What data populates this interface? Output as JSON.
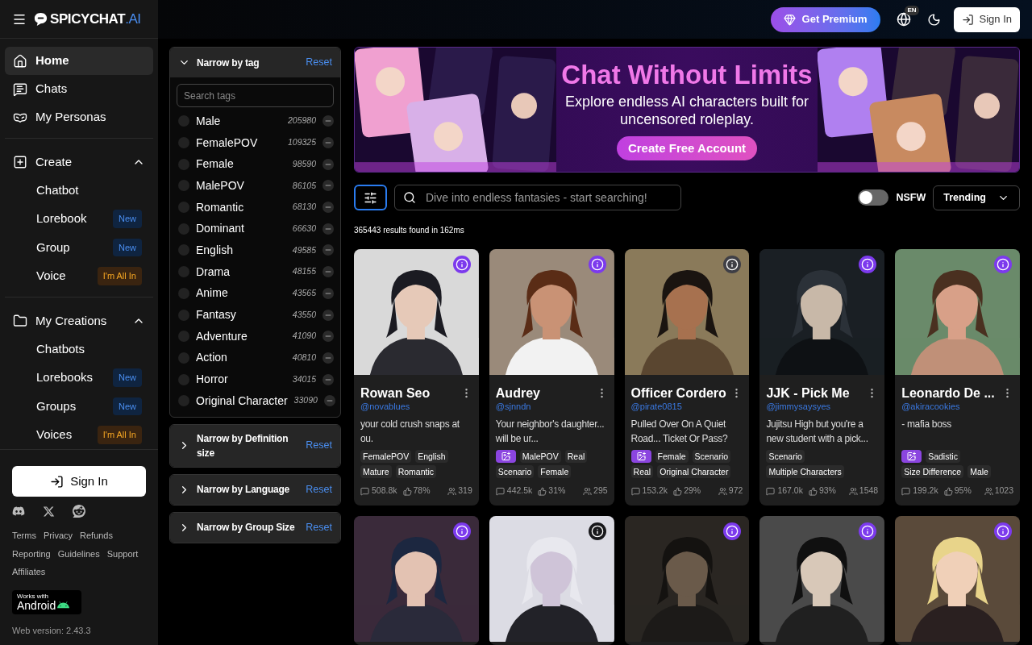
{
  "sidebar": {
    "logo": {
      "main": "SPICYCHAT",
      "suffix": ".AI"
    },
    "nav": [
      {
        "label": "Home",
        "selected": true
      },
      {
        "label": "Chats",
        "selected": false
      },
      {
        "label": "My Personas",
        "selected": false
      }
    ],
    "sections": [
      {
        "label": "Create",
        "expanded": true,
        "items": [
          {
            "label": "Chatbot"
          },
          {
            "label": "Lorebook",
            "badge": {
              "text": "New",
              "kind": "new"
            }
          },
          {
            "label": "Group",
            "badge": {
              "text": "New",
              "kind": "new"
            }
          },
          {
            "label": "Voice",
            "badge": {
              "text": "I'm All In",
              "kind": "premium"
            }
          }
        ]
      },
      {
        "label": "My Creations",
        "expanded": true,
        "items": [
          {
            "label": "Chatbots"
          },
          {
            "label": "Lorebooks",
            "badge": {
              "text": "New",
              "kind": "new"
            }
          },
          {
            "label": "Groups",
            "badge": {
              "text": "New",
              "kind": "new"
            }
          },
          {
            "label": "Voices",
            "badge": {
              "text": "I'm All In",
              "kind": "premium"
            }
          }
        ]
      }
    ],
    "sign_in": "Sign In",
    "links": [
      "Terms",
      "Privacy",
      "Refunds",
      "Reporting",
      "Guidelines",
      "Support",
      "Affiliates"
    ],
    "android_badge": {
      "small": "Works with",
      "big": "Android"
    },
    "version": "Web version: 2.43.3"
  },
  "header": {
    "premium": "Get Premium",
    "language": "EN",
    "sign_in": "Sign In"
  },
  "filters": [
    {
      "kind": "tags",
      "title": "Narrow by tag",
      "reset": "Reset",
      "expanded": true,
      "search_placeholder": "Search tags",
      "tags": [
        {
          "label": "Male",
          "count": "205980",
          "checked": false
        },
        {
          "label": "FemalePOV",
          "count": "109325",
          "checked": false
        },
        {
          "label": "Female",
          "count": "98590",
          "checked": false
        },
        {
          "label": "MalePOV",
          "count": "86105",
          "checked": false
        },
        {
          "label": "Romantic",
          "count": "68130",
          "checked": false
        },
        {
          "label": "Dominant",
          "count": "66630",
          "checked": false
        },
        {
          "label": "English",
          "count": "49585",
          "checked": false
        },
        {
          "label": "Drama",
          "count": "48155",
          "checked": false
        },
        {
          "label": "Anime",
          "count": "43565",
          "checked": false
        },
        {
          "label": "Fantasy",
          "count": "43550",
          "checked": false
        },
        {
          "label": "Adventure",
          "count": "41090",
          "checked": false
        },
        {
          "label": "Action",
          "count": "40810",
          "checked": false
        },
        {
          "label": "Horror",
          "count": "34015",
          "checked": false
        },
        {
          "label": "Original Character",
          "count": "33090",
          "checked": false
        }
      ]
    },
    {
      "kind": "plain",
      "title": "Narrow by Definition size",
      "reset": "Reset",
      "expanded": false
    },
    {
      "kind": "plain",
      "title": "Narrow by Language",
      "reset": "Reset",
      "expanded": false
    },
    {
      "kind": "plain",
      "title": "Narrow by Group Size",
      "reset": "Reset",
      "expanded": false
    }
  ],
  "banner": {
    "title": "Chat Without Limits",
    "subtitle": "Explore endless AI characters built for uncensored roleplay.",
    "button": "Create Free Account"
  },
  "toolbar": {
    "search_placeholder": "Dive into endless fantasies - start searching!",
    "nsfw": {
      "label": "NSFW",
      "on": false
    },
    "sort": "Trending",
    "results": "365443 results found in 162ms"
  },
  "cards": [
    {
      "kind": "full",
      "color": "#7c3aed",
      "name": "Rowan Seo",
      "handle": "@novablues",
      "description": "your cold crush snaps at ou.",
      "image_badge": false,
      "tags": [
        "FemalePOV",
        "English",
        "Mature",
        "Romantic"
      ],
      "messages": "508.8k",
      "likes": "78%",
      "count": "319"
    },
    {
      "kind": "full",
      "color": "#7c3aed",
      "name": "Audrey",
      "handle": "@sjnndn",
      "description": "Your neighbor's daughter... will be ur...",
      "image_badge": true,
      "tags": [
        "MalePOV",
        "Real",
        "Scenario",
        "Female"
      ],
      "messages": "442.5k",
      "likes": "31%",
      "count": "295"
    },
    {
      "kind": "full",
      "color": "#3f3f46",
      "name": "Officer Cordero",
      "handle": "@pirate0815",
      "description": "Pulled Over On A Quiet Road... Ticket Or Pass?",
      "image_badge": true,
      "tags": [
        "Female",
        "Scenario",
        "Real",
        "Original Character"
      ],
      "messages": "153.2k",
      "likes": "29%",
      "count": "972"
    },
    {
      "kind": "full",
      "color": "#7c3aed",
      "name": "JJK - Pick Me",
      "handle": "@jimmysaysyes",
      "description": "Jujitsu High but you're a new student with a pick...",
      "image_badge": false,
      "tags": [
        "Scenario",
        "Multiple Characters"
      ],
      "messages": "167.0k",
      "likes": "93%",
      "count": "1548"
    },
    {
      "kind": "full",
      "color": "#7c3aed",
      "name": "Leonardo De ...",
      "handle": "@akiracookies",
      "description": "- mafia boss",
      "image_badge": true,
      "tags": [
        "Sadistic",
        "Size Difference",
        "Male"
      ],
      "messages": "199.2k",
      "likes": "95%",
      "count": "1023"
    },
    {
      "kind": "partial",
      "color": "#7c3aed"
    },
    {
      "kind": "partial",
      "color": "#18181b"
    },
    {
      "kind": "partial",
      "color": "#7c3aed"
    },
    {
      "kind": "partial",
      "color": "#7c3aed"
    },
    {
      "kind": "partial",
      "color": "#7c3aed"
    }
  ]
}
